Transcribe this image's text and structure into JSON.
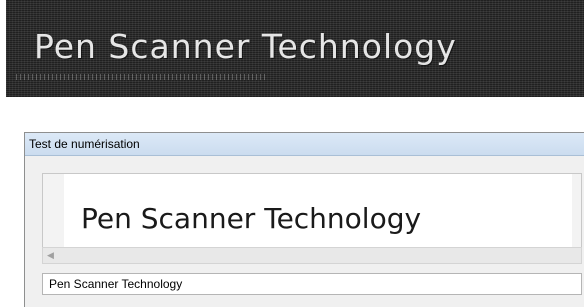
{
  "banner": {
    "text": "Pen Scanner Technology"
  },
  "window": {
    "title": "Test de numérisation",
    "preview_text": "Pen Scanner Technology",
    "scroll_left_icon": "chevron-left-icon",
    "result_text": "Pen Scanner Technology"
  }
}
